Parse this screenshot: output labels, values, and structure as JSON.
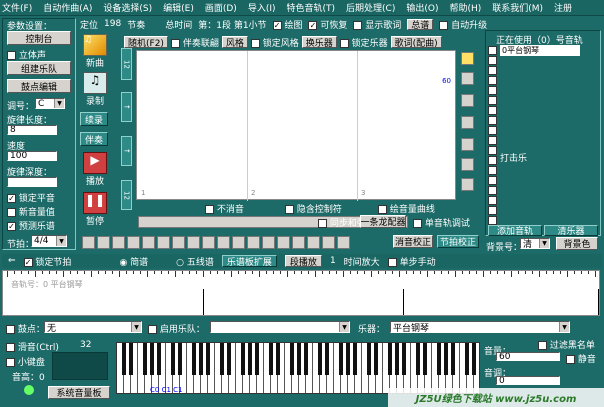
{
  "menu": [
    "文件(F)",
    "自动作曲(A)",
    "设备选择(S)",
    "编辑(E)",
    "画面(D)",
    "导入(I)",
    "特色音轨(T)",
    "后期处理(C)",
    "输出(O)",
    "帮助(H)",
    "联系我们(M)",
    "注册"
  ],
  "left": {
    "title": "参数设置：",
    "control_btn": "控制台",
    "stereo": "立体声",
    "group_btn": "组建乐队",
    "drum_btn": "鼓点编辑",
    "key_lbl": "调号：",
    "key_val": "C",
    "rhythm_lbl": "旋律长度：",
    "rhythm_val": "8",
    "speed_lbl": "速度",
    "speed_val": "100",
    "motion_lbl": "旋律深度：",
    "motion_val": "",
    "chk_fixed": "锁定平音",
    "chk_new": "新音量值",
    "chk_pre": "预测乐谱",
    "beat_lbl": "节拍：",
    "beat_val": "4/4"
  },
  "info": {
    "pos_lbl": "定位",
    "pos_val": "198",
    "beat_lbl": "节奏",
    "total_lbl": "总时间",
    "section_lbl": "第：1段 第1小节",
    "chk_draw": "绘图",
    "chk_recover": "可恢复",
    "show_lyrics": "显示歌词",
    "total_score": "总谱",
    "auto_upgrade": "自动升级"
  },
  "actions": {
    "new": "新曲",
    "record": "录制",
    "continue": "续录",
    "accompany": "伴奏",
    "play": "播放",
    "pause": "暂停"
  },
  "toolbar": {
    "random": "随机(F2)",
    "chk_emotion": "伴奏联翩",
    "style": "风格",
    "chk_lock_style": "锁定风格",
    "replace": "换乐器",
    "chk_lock_instr": "锁定乐器",
    "lyrics_match": "歌词(配曲)"
  },
  "canvas": {
    "marker": "60",
    "track_label": "打击乐",
    "beat_nums": [
      "1",
      "2",
      "3"
    ],
    "chk_mute": "不消音",
    "chk_hide": "隐含控制符",
    "chk_curve": "绘音量曲线",
    "chk_sync": "同步和弦",
    "chord_btn": "一条龙配器",
    "chk_single": "单音轨调试",
    "fix_btn": "消音校正",
    "beat_fix": "节拍校正"
  },
  "tracks": {
    "title": "正在使用（0）号音轨",
    "items": [
      "0平台钢琴",
      "",
      "",
      "",
      "",
      "",
      "",
      "",
      "",
      "",
      "",
      "",
      "",
      "",
      "",
      "",
      "",
      ""
    ],
    "add_btn": "添加音轨",
    "clear_btn": "清乐器",
    "bg_lbl": "背景号：",
    "bg_val": "清",
    "bg_color": "背景色"
  },
  "score_bar": {
    "chk_lock": "锁定节拍",
    "simple": "简谱",
    "staff": "五线谱",
    "expand": "乐谱板扩展",
    "segment": "段播放",
    "zoom_lbl": "时间放大",
    "zoom_val": "1",
    "chk_manual": "单步手动",
    "label": "音轨号：0 平台钢琴"
  },
  "bottom": {
    "chk_drum": "鼓点：",
    "drum_val": "无",
    "chk_band": "启用乐队：",
    "band_val": "",
    "instr_lbl": "乐器：",
    "instr_val": "平台钢琴",
    "chk_glide": "滑音(Ctrl)",
    "glide_num": "32",
    "chk_keyboard": "小键盘",
    "vol_lbl": "音高：0",
    "sys_vol": "系统音量板",
    "volume_lbl": "音量：",
    "volume_val": "60",
    "chk_rest": "过滤黑名单",
    "chk_mute2": "静音",
    "pitch_lbl": "音调：",
    "pitch_val": "0",
    "key_note": "C0 C1 C1"
  },
  "watermark": "JZ5U绿色下载站 www.jz5u.com"
}
